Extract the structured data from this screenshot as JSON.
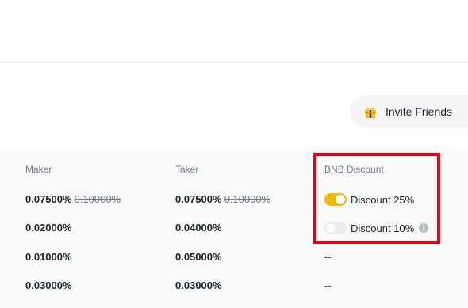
{
  "invite": {
    "label": "Invite Friends",
    "icon": "gift-icon"
  },
  "table": {
    "headers": {
      "maker": "Maker",
      "taker": "Taker",
      "bnb": "BNB Discount"
    },
    "rows": [
      {
        "maker": "0.07500%",
        "maker_orig": "0.10000%",
        "taker": "0.07500%",
        "taker_orig": "0.10000%"
      },
      {
        "maker": "0.02000%",
        "taker": "0.04000%"
      },
      {
        "maker": "0.01000%",
        "taker": "0.05000%"
      },
      {
        "maker": "0.03000%",
        "taker": "0.03000%"
      }
    ],
    "discounts": [
      {
        "label": "Discount 25%",
        "enabled": true
      },
      {
        "label": "Discount 10%",
        "enabled": false,
        "info_icon": "info-icon"
      }
    ],
    "empty_value": "--"
  },
  "colors": {
    "accent": "#f0b90b",
    "highlight": "#e8000e"
  }
}
